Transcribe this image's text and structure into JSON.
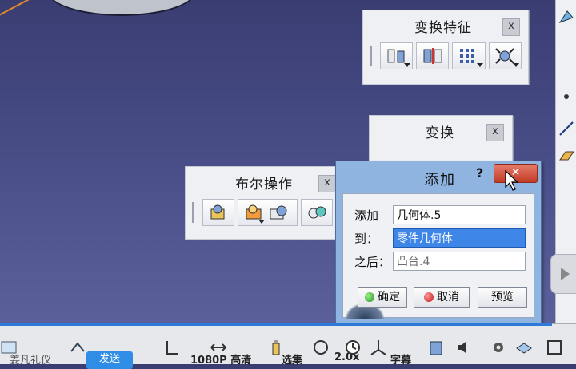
{
  "toolbars": {
    "transform_features": {
      "title": "变换特征",
      "close": "x"
    },
    "transform": {
      "title": "变换",
      "close": "x"
    },
    "boolean": {
      "title": "布尔操作",
      "close": "x"
    }
  },
  "dialog": {
    "title": "添加",
    "help": "?",
    "close": "✕",
    "rows": [
      {
        "label": "添加",
        "value": "几何体.5"
      },
      {
        "label": "到：",
        "value": "零件几何体"
      },
      {
        "label": "之后：",
        "value": "凸台.4"
      }
    ],
    "buttons": {
      "ok": "确定",
      "cancel": "取消",
      "preview": "预览"
    }
  },
  "bottom": {
    "left_text": "姜凡礼仪",
    "send": "发送",
    "quality": "1080P 高清",
    "episodes": "选集",
    "speed": "2.0x",
    "extra": "字幕"
  },
  "colors": {
    "accent": "#3d86e8",
    "close_red": "#c23b26"
  }
}
